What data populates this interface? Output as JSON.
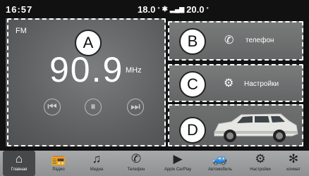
{
  "status": {
    "time_left": "16:57",
    "temp_outside": "18.0",
    "temp_unit": "°",
    "temp_inside": "20.0"
  },
  "radio": {
    "band": "FM",
    "frequency": "90.9",
    "unit": "MHz",
    "callout": "A"
  },
  "tiles": {
    "phone": {
      "callout": "B",
      "label": "телефон"
    },
    "settings": {
      "callout": "C",
      "label": "Настройки"
    },
    "vehicle": {
      "callout": "D"
    }
  },
  "nav": [
    {
      "label": "Главная",
      "icon": "home-icon"
    },
    {
      "label": "Радио",
      "icon": "radio-icon"
    },
    {
      "label": "Медиа",
      "icon": "music-icon"
    },
    {
      "label": "Телефон",
      "icon": "phone-icon"
    },
    {
      "label": "Apple CarPlay",
      "icon": "carplay-icon"
    },
    {
      "label": "Автомобиль",
      "icon": "car-icon"
    },
    {
      "label": "Настройки",
      "icon": "gear-icon"
    },
    {
      "label": "климат",
      "icon": "fan-icon"
    }
  ]
}
